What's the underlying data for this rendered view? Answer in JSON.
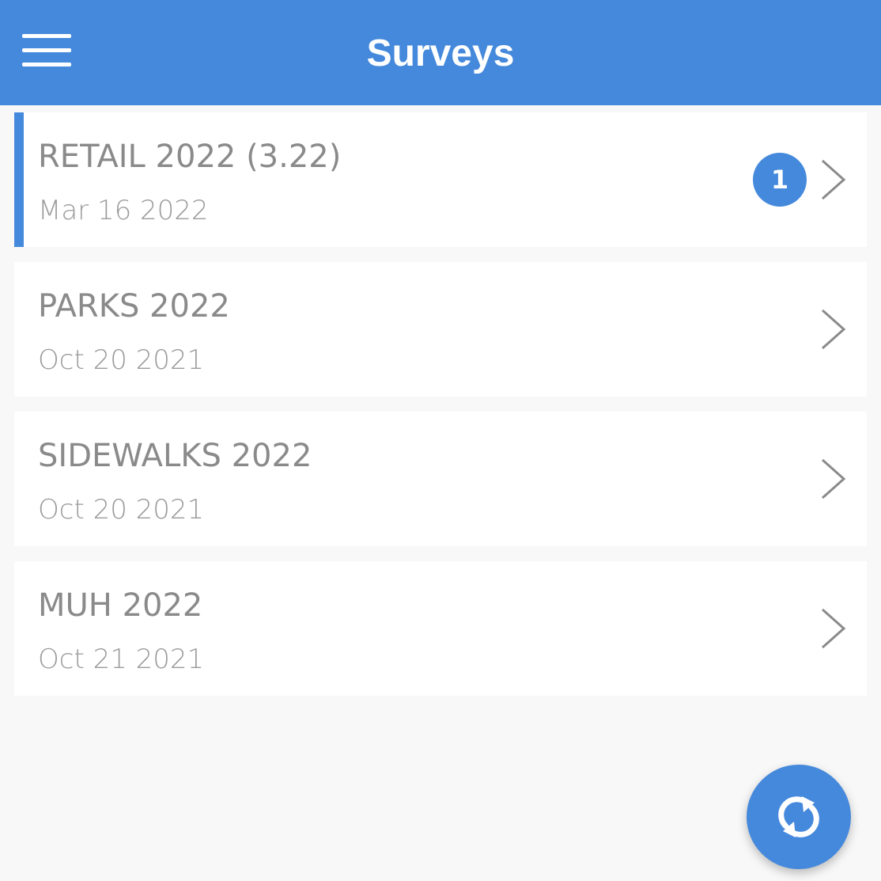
{
  "app_bar": {
    "title": "Surveys",
    "menu_icon": "hamburger-menu-icon"
  },
  "surveys": [
    {
      "title": "RETAIL 2022 (3.22)",
      "date": "Mar 16 2022",
      "badge": "1",
      "active": true
    },
    {
      "title": "PARKS 2022",
      "date": "Oct 20 2021",
      "badge": null,
      "active": false
    },
    {
      "title": "SIDEWALKS 2022",
      "date": "Oct 20 2021",
      "badge": null,
      "active": false
    },
    {
      "title": "MUH 2022",
      "date": "Oct 21 2021",
      "badge": null,
      "active": false
    }
  ],
  "fab": {
    "icon": "sync-icon"
  },
  "colors": {
    "primary": "#4589dc",
    "background": "#f8f8f8",
    "card": "#ffffff",
    "title_text": "#8a8a8a",
    "date_text": "#9b9b9b"
  }
}
